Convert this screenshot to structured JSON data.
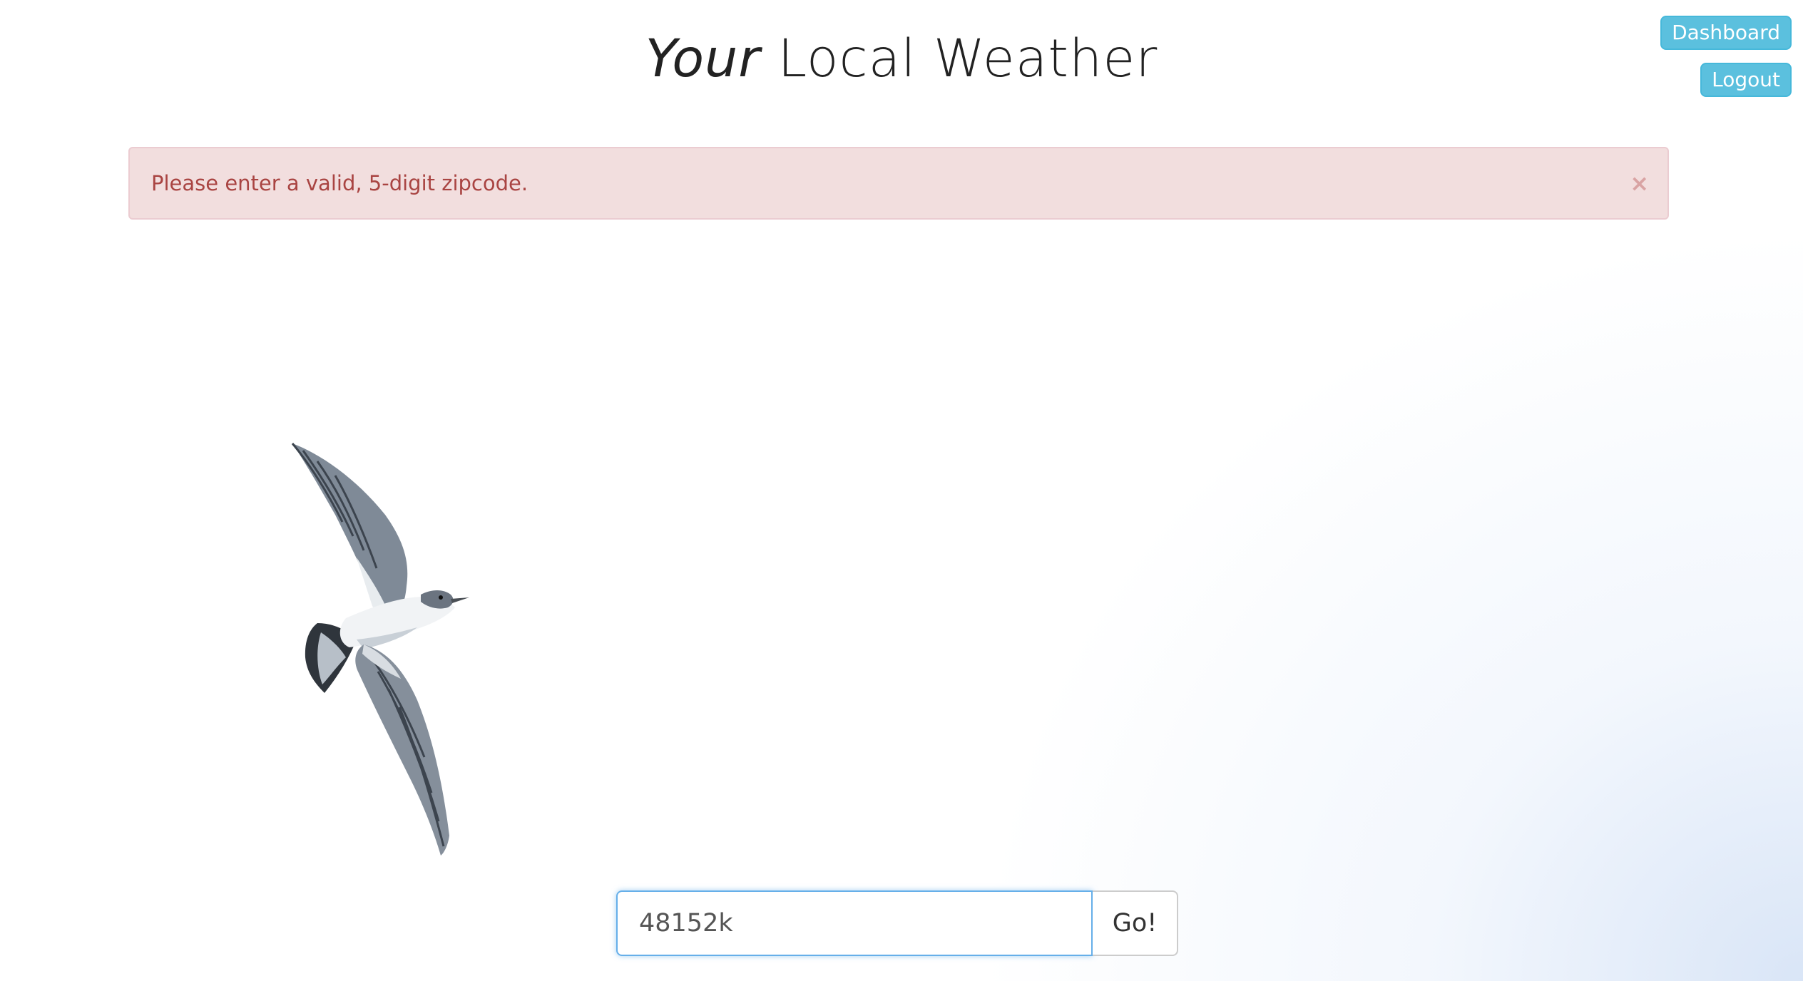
{
  "header": {
    "title_emphasis": "Your",
    "title_rest": " Local Weather"
  },
  "nav": {
    "dashboard_label": "Dashboard",
    "logout_label": "Logout"
  },
  "alert": {
    "message": "Please enter a valid, 5-digit zipcode.",
    "close_glyph": "×"
  },
  "search": {
    "zip_value": "48152k",
    "submit_label": "Go!"
  },
  "colors": {
    "info_button": "#5bc0de",
    "alert_background": "#f2dede",
    "alert_text": "#a94442",
    "input_focus_border": "#66afe9"
  },
  "illustration": {
    "subject": "seagull-in-flight"
  }
}
